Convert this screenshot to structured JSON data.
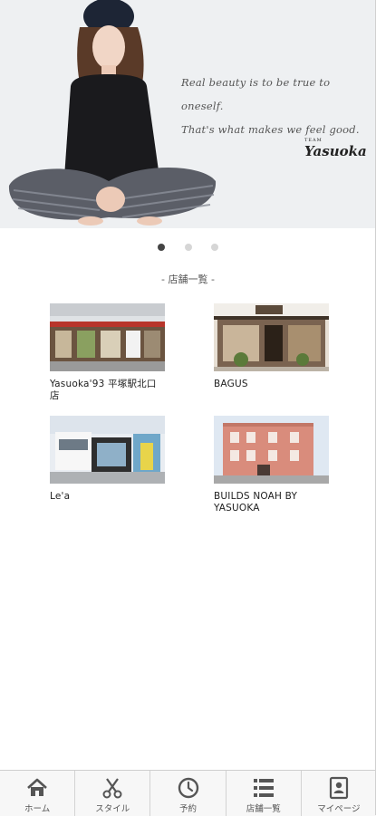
{
  "hero": {
    "quote_line1": "Real beauty is to be true to oneself.",
    "quote_line2": "That's what makes we feel good.",
    "brand_team": "TEAM",
    "brand_name": "Yasuoka"
  },
  "carousel": {
    "total": 3,
    "active": 1
  },
  "section": {
    "title": "- 店舗一覧 -"
  },
  "shops": [
    {
      "name": "Yasuoka'93 平塚駅北口店"
    },
    {
      "name": "BAGUS"
    },
    {
      "name": "Le'a"
    },
    {
      "name": "BUILDS NOAH BY YASUOKA"
    }
  ],
  "tabs": [
    {
      "label": "ホーム",
      "icon": "home-icon"
    },
    {
      "label": "スタイル",
      "icon": "scissors-icon"
    },
    {
      "label": "予約",
      "icon": "clock-icon"
    },
    {
      "label": "店舗一覧",
      "icon": "list-icon"
    },
    {
      "label": "マイページ",
      "icon": "id-card-icon"
    }
  ],
  "colors": {
    "icon": "#555555",
    "tab_bg": "#f7f7f7",
    "dot_active": "#444444"
  }
}
